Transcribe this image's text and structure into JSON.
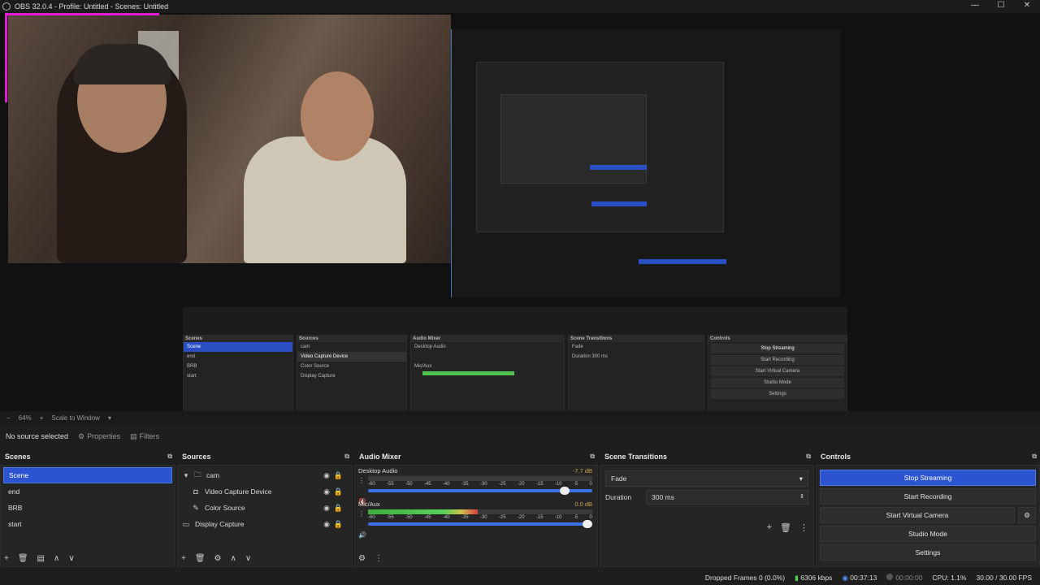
{
  "window": {
    "title": "OBS 32.0.4 - Profile: Untitled - Scenes: Untitled",
    "controls": [
      "—",
      "☐",
      "✕"
    ]
  },
  "preview_bar": {
    "zoom": "64%",
    "scale_mode": "Scale to Window"
  },
  "source_bar": {
    "no_source": "No source selected",
    "properties": "Properties",
    "filters": "Filters"
  },
  "scenes": {
    "title": "Scenes",
    "items": [
      "Scene",
      "end",
      "BRB",
      "start"
    ],
    "selected": "Scene"
  },
  "sources": {
    "title": "Sources",
    "items": [
      {
        "label": "cam",
        "icon": "folder-icon"
      },
      {
        "label": "Video Capture Device",
        "icon": "camera-icon"
      },
      {
        "label": "Color Source",
        "icon": "brush-icon"
      },
      {
        "label": "Display Capture",
        "icon": "monitor-icon"
      }
    ]
  },
  "audio_mixer": {
    "title": "Audio Mixer",
    "channels": [
      {
        "name": "Desktop Audio",
        "db": "-7.7 dB",
        "level": 0.0,
        "volume": 0.9
      },
      {
        "name": "Mic/Aux",
        "db": "0.0 dB",
        "level": 0.49,
        "volume": 1.0
      }
    ],
    "ticks": [
      "-60",
      "-55",
      "-50",
      "-45",
      "-40",
      "-35",
      "-30",
      "-25",
      "-20",
      "-15",
      "-10",
      "-5",
      "0"
    ]
  },
  "scene_transitions": {
    "title": "Scene Transitions",
    "transition": "Fade",
    "duration_label": "Duration",
    "duration_value": "300 ms"
  },
  "controls": {
    "title": "Controls",
    "buttons": [
      "Stop Streaming",
      "Start Recording",
      "Start Virtual Camera",
      "Studio Mode",
      "Settings"
    ]
  },
  "status": {
    "dropped_frames": "Dropped Frames 0 (0.0%)",
    "bitrate": "6306 kbps",
    "stream_time": "00:37:13",
    "rec_time": "00:00:00",
    "cpu": "CPU: 1.1%",
    "fps": "30.00 / 30.00 FPS"
  },
  "colors": {
    "accent": "#2c53d0",
    "meter_green": "#58d15a",
    "border_magenta": "#e01bd0"
  }
}
